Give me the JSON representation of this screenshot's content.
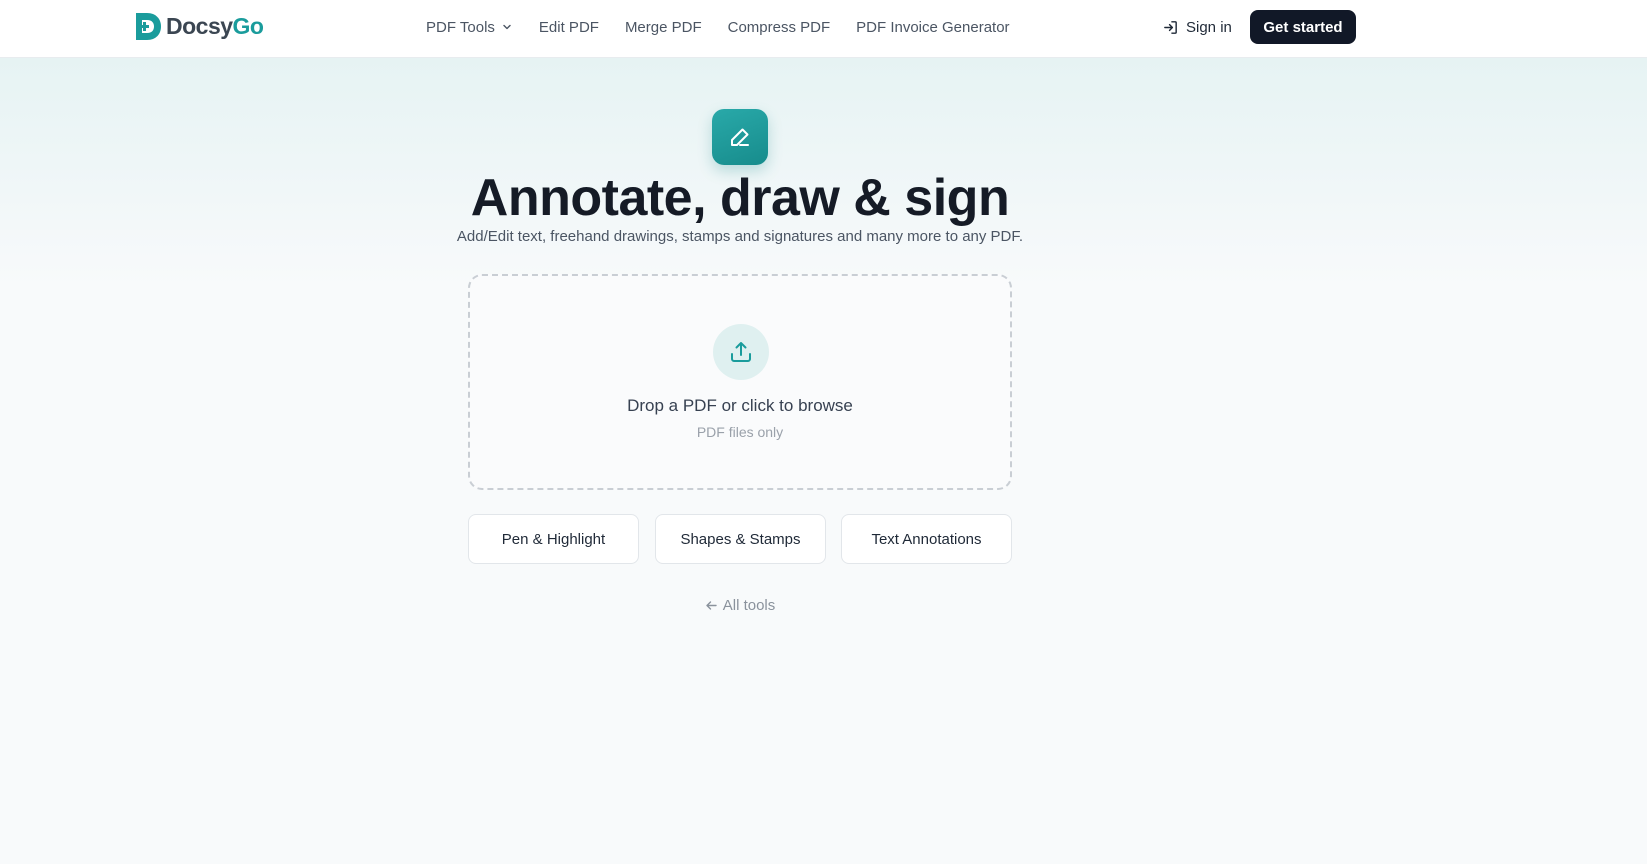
{
  "brand": {
    "name_part1": "Docsy",
    "name_part2": "Go",
    "color": "#1a9c9c",
    "logo_icon": "docsygo-logo-icon"
  },
  "nav": {
    "items": [
      {
        "label": "PDF Tools",
        "has_dropdown": true
      },
      {
        "label": "Edit PDF"
      },
      {
        "label": "Merge PDF"
      },
      {
        "label": "Compress PDF"
      },
      {
        "label": "PDF Invoice Generator"
      }
    ],
    "signin_label": "Sign in",
    "signin_icon": "sign-in-icon",
    "cta_label": "Get started"
  },
  "hero": {
    "icon": "pen-icon",
    "title": "Annotate, draw & sign",
    "subtitle": "Add/Edit text, freehand drawings, stamps and signatures and many more to any PDF."
  },
  "dropzone": {
    "icon": "upload-icon",
    "label": "Drop a PDF or click to browse",
    "sublabel": "PDF files only"
  },
  "tools": [
    {
      "label": "Pen & Highlight"
    },
    {
      "label": "Shapes & Stamps"
    },
    {
      "label": "Text Annotations"
    }
  ],
  "back_link": {
    "label": "All tools",
    "icon": "arrow-left-icon"
  },
  "colors": {
    "accent": "#1a9c9c",
    "dark": "#111827",
    "accent_light": "#dff0f0"
  }
}
